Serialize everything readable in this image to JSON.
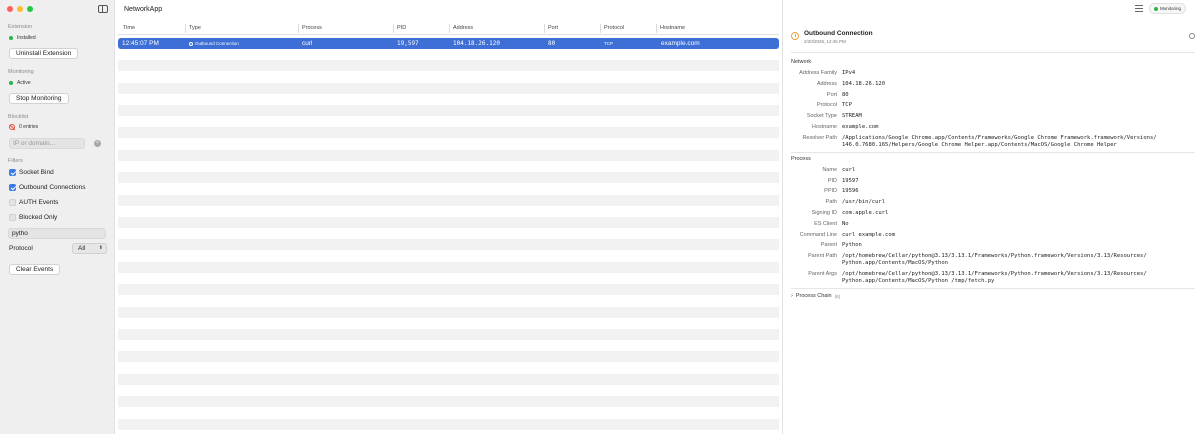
{
  "app": {
    "title": "NetworkApp"
  },
  "sidebar": {
    "extension": {
      "title": "Extension",
      "status": "Installed",
      "button": "Uninstall Extension"
    },
    "monitoring": {
      "title": "Monitoring",
      "status": "Active",
      "button": "Stop Monitoring"
    },
    "blocklist": {
      "title": "Blocklist",
      "entries": "0 entries",
      "placeholder": "IP or domain..."
    },
    "filters": {
      "title": "Filters",
      "socket_bind": "Socket Bind",
      "outbound": "Outbound Connections",
      "auth": "AUTH Events",
      "blocked": "Blocked Only",
      "search_value": "pytho",
      "protocol_label": "Protocol",
      "protocol_value": "All"
    },
    "clear_button": "Clear Events"
  },
  "table": {
    "headers": {
      "time": "Time",
      "type": "Type",
      "process": "Process",
      "pid": "PID",
      "address": "Address",
      "port": "Port",
      "protocol": "Protocol",
      "hostname": "Hostname"
    },
    "selected_row": {
      "time": "12:45:07 PM",
      "type": "Outbound Connection",
      "process": "curl",
      "pid": "19,597",
      "address": "104.18.26.120",
      "port": "80",
      "protocol": "TCP",
      "hostname": "example.com"
    }
  },
  "toolbar": {
    "monitoring_pill": "Monitoring"
  },
  "detail": {
    "title": "Outbound Connection",
    "subtitle": "2/20/2026, 12:45 PM",
    "network": {
      "title": "Network",
      "address_family_label": "Address Family",
      "address_family": "IPv4",
      "address_label": "Address",
      "address": "104.18.26.120",
      "port_label": "Port",
      "port": "80",
      "protocol_label": "Protocol",
      "protocol": "TCP",
      "socket_type_label": "Socket Type",
      "socket_type": "STREAM",
      "hostname_label": "Hostname",
      "hostname": "example.com",
      "resolver_path_label": "Resolver Path",
      "resolver_path": "/Applications/Google Chrome.app/Contents/Frameworks/Google Chrome Framework.framework/Versions/\n146.0.7680.165/Helpers/Google Chrome Helper.app/Contents/MacOS/Google Chrome Helper"
    },
    "process": {
      "title": "Process",
      "name_label": "Name",
      "name": "curl",
      "pid_label": "PID",
      "pid": "19597",
      "ppid_label": "PPID",
      "ppid": "19596",
      "path_label": "Path",
      "path": "/usr/bin/curl",
      "signing_id_label": "Signing ID",
      "signing_id": "com.apple.curl",
      "es_client_label": "ES Client",
      "es_client": "No",
      "command_line_label": "Command Line",
      "command_line": "curl example.com",
      "parent_label": "Parent",
      "parent": "Python",
      "parent_path_label": "Parent Path",
      "parent_path": "/opt/homebrew/Cellar/python@3.13/3.13.1/Frameworks/Python.framework/Versions/3.13/Resources/\nPython.app/Contents/MacOS/Python",
      "parent_args_label": "Parent Args",
      "parent_args": "/opt/homebrew/Cellar/python@3.13/3.13.1/Frameworks/Python.framework/Versions/3.13/Resources/\nPython.app/Contents/MacOS/Python /tmp/fetch.py"
    },
    "process_chain": {
      "label": "Process Chain",
      "count": "(6)"
    }
  }
}
